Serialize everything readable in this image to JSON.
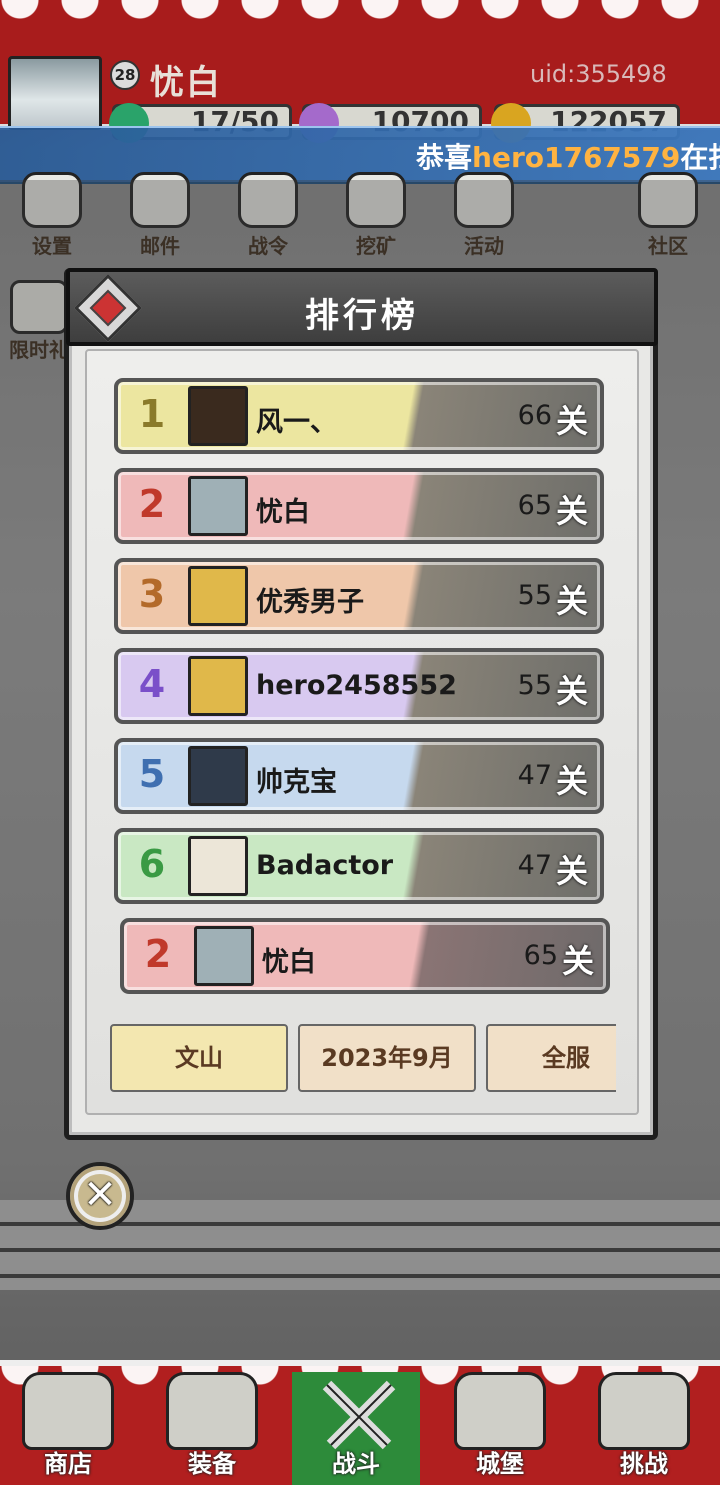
{
  "player": {
    "level": "28",
    "name": "忧白",
    "uid": "uid:355498"
  },
  "resources": {
    "stamina": "17/50",
    "gems": "10700",
    "gold": "122057"
  },
  "marquee": {
    "prefix": "恭喜",
    "hero": "hero1767579",
    "suffix": "在扫荡"
  },
  "top_icons": [
    "设置",
    "邮件",
    "战令",
    "挖矿",
    "活动",
    "社区"
  ],
  "side_icon": "限时礼",
  "leaderboard": {
    "title": "排行榜",
    "rows": [
      {
        "rank": "1",
        "name": "风一、",
        "score": "66",
        "unit": "关"
      },
      {
        "rank": "2",
        "name": "忧白",
        "score": "65",
        "unit": "关"
      },
      {
        "rank": "3",
        "name": "优秀男子",
        "score": "55",
        "unit": "关"
      },
      {
        "rank": "4",
        "name": "hero2458552",
        "score": "55",
        "unit": "关"
      },
      {
        "rank": "5",
        "name": "帅克宝",
        "score": "47",
        "unit": "关"
      },
      {
        "rank": "6",
        "name": "Badactor",
        "score": "47",
        "unit": "关"
      }
    ],
    "mine": {
      "rank": "2",
      "name": "忧白",
      "score": "65",
      "unit": "关"
    },
    "tabs": [
      "文山",
      "2023年9月",
      "全服"
    ]
  },
  "colors": {
    "row1": "#ece6a0",
    "row2": "#efb9b9",
    "row3": "#efc7aa",
    "row4": "#d8c9f0",
    "row5": "#c6d9ee",
    "row6": "#c9e8c3",
    "active_tab": "#f3e7b0",
    "nav_active": "#2d8b3a"
  },
  "bottom_nav": [
    "商店",
    "装备",
    "战斗",
    "城堡",
    "挑战"
  ]
}
